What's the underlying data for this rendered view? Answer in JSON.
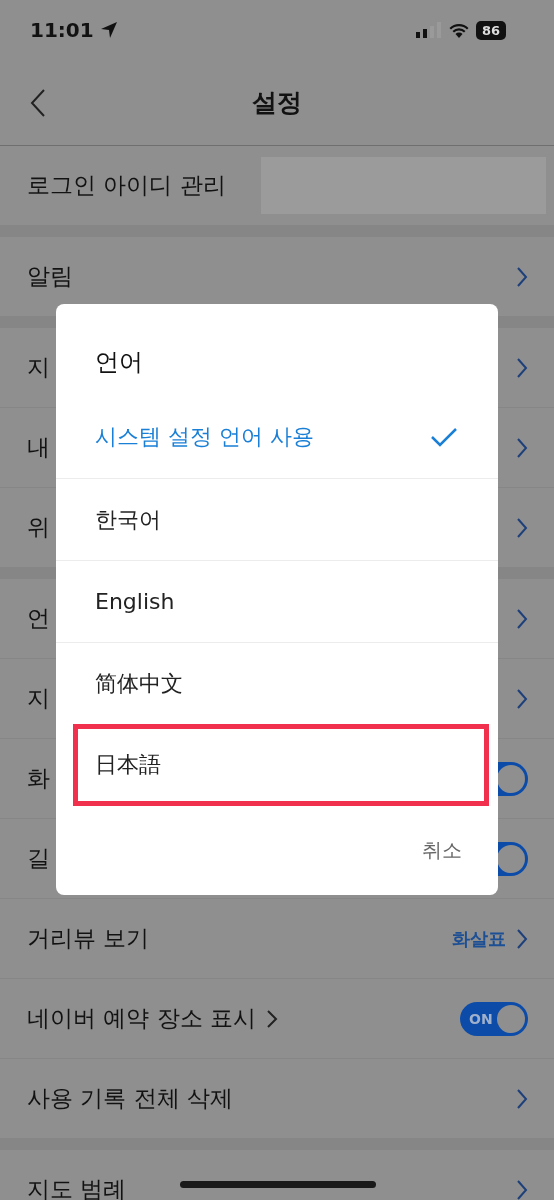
{
  "status_bar": {
    "time": "11:01",
    "battery": "86"
  },
  "header": {
    "title": "설정"
  },
  "groups": [
    {
      "rows": [
        {
          "label": "로그인 아이디 관리",
          "kind": "redacted"
        }
      ]
    },
    {
      "rows": [
        {
          "label": "알림",
          "kind": "chevron"
        }
      ]
    },
    {
      "rows": [
        {
          "label": "지",
          "kind": "chevron"
        },
        {
          "label": "내",
          "kind": "chevron"
        },
        {
          "label": "위",
          "kind": "chevron"
        }
      ]
    },
    {
      "rows": [
        {
          "label": "언",
          "kind": "chevron"
        },
        {
          "label": "지",
          "kind": "chevron"
        },
        {
          "label": "화",
          "kind": "toggle",
          "on": true
        },
        {
          "label": "길",
          "kind": "toggle",
          "on": true
        },
        {
          "label": "거리뷰 보기",
          "kind": "value",
          "value": "화살표"
        },
        {
          "label": "네이버 예약 장소 표시",
          "kind": "toggle",
          "on": true,
          "link": true,
          "toggle_text": "ON"
        },
        {
          "label": "사용 기록 전체 삭제",
          "kind": "chevron"
        }
      ]
    },
    {
      "rows": [
        {
          "label": "지도 범례",
          "kind": "chevron"
        }
      ]
    }
  ],
  "dialog": {
    "title": "언어",
    "options": [
      {
        "label": "시스템 설정 언어 사용",
        "selected": true,
        "highlighted": false
      },
      {
        "label": "한국어",
        "selected": false,
        "highlighted": false
      },
      {
        "label": "English",
        "selected": false,
        "highlighted": false
      },
      {
        "label": "简体中文",
        "selected": false,
        "highlighted": false
      },
      {
        "label": "日本語",
        "selected": false,
        "highlighted": true
      }
    ],
    "cancel": "취소"
  }
}
